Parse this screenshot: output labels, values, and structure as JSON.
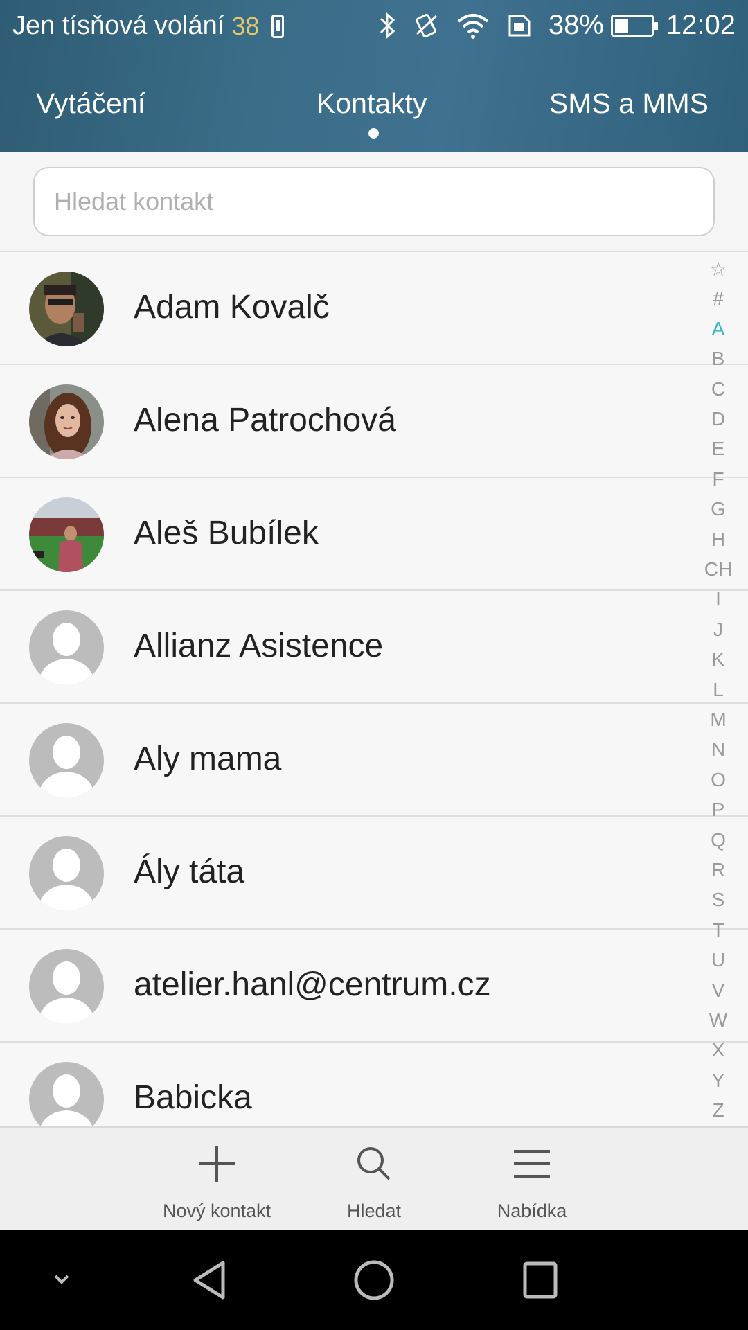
{
  "status": {
    "carrier_text": "Jen tísňová volání",
    "signal_count": "38",
    "battery_percent": "38%",
    "battery_level": 0.38,
    "time": "12:02",
    "icons": [
      "phone-icon",
      "bluetooth-icon",
      "vibrate-icon",
      "wifi-icon",
      "sim-icon",
      "battery-icon"
    ]
  },
  "tabs": [
    {
      "label": "Vytáčení"
    },
    {
      "label": "Kontakty",
      "active": true
    },
    {
      "label": "SMS a MMS"
    }
  ],
  "search": {
    "placeholder": "Hledat kontakt"
  },
  "contacts": [
    {
      "name": "Adam Kovalč",
      "avatar": "photo"
    },
    {
      "name": "Alena Patrochová",
      "avatar": "photo"
    },
    {
      "name": "Aleš Bubílek",
      "avatar": "photo"
    },
    {
      "name": "Allianz Asistence",
      "avatar": "placeholder"
    },
    {
      "name": "Aly mama",
      "avatar": "placeholder"
    },
    {
      "name": "Ály táta",
      "avatar": "placeholder"
    },
    {
      "name": "atelier.hanl@centrum.cz",
      "avatar": "placeholder"
    },
    {
      "name": "Babicka",
      "avatar": "placeholder"
    }
  ],
  "alphabet_index": {
    "letters": [
      "☆",
      "#",
      "A",
      "B",
      "C",
      "D",
      "E",
      "F",
      "G",
      "H",
      "CH",
      "I",
      "J",
      "K",
      "L",
      "M",
      "N",
      "O",
      "P",
      "Q",
      "R",
      "S",
      "T",
      "U",
      "V",
      "W",
      "X",
      "Y",
      "Z"
    ],
    "active": "A",
    "active_color": "#3bb3c7"
  },
  "toolbar": {
    "new_contact_label": "Nový kontakt",
    "search_label": "Hledat",
    "menu_label": "Nabídka"
  },
  "colors": {
    "header_bg": "#3a6d88",
    "signal_count": "#e4c96b"
  }
}
